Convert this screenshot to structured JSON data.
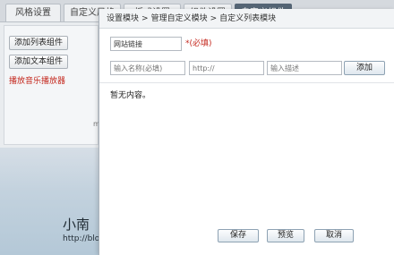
{
  "background": {
    "tabs": [
      {
        "label": "风格设置",
        "active": false
      },
      {
        "label": "自定义风格",
        "active": false
      },
      {
        "label": "板式设置",
        "active": false
      },
      {
        "label": "组件设置",
        "active": false
      },
      {
        "label": "自定义组件",
        "active": true
      }
    ],
    "sidebar": {
      "add_list_widget": "添加列表组件",
      "add_text_widget": "添加文本组件",
      "music_player_link": "播放音乐播放器"
    },
    "edge_char": "m",
    "blog": {
      "title": "小南",
      "url": "http://blo"
    }
  },
  "modal": {
    "breadcrumb": [
      "设置模块",
      "管理自定义模块",
      "自定义列表模块"
    ],
    "breadcrumb_separator": ">",
    "name_input": {
      "value": "网站链接",
      "hint": "*(必填)"
    },
    "row_inputs": {
      "name_placeholder": "输入名称(必填)",
      "url_placeholder": "http://",
      "desc_placeholder": "输入描述"
    },
    "add_button": "添加",
    "empty_message": "暂无内容。",
    "footer": {
      "save": "保存",
      "preview": "预览",
      "cancel": "取消"
    }
  },
  "colors": {
    "active_tab": "#556575",
    "required_hint": "#c4281e",
    "button_border": "#8ea2b3"
  }
}
